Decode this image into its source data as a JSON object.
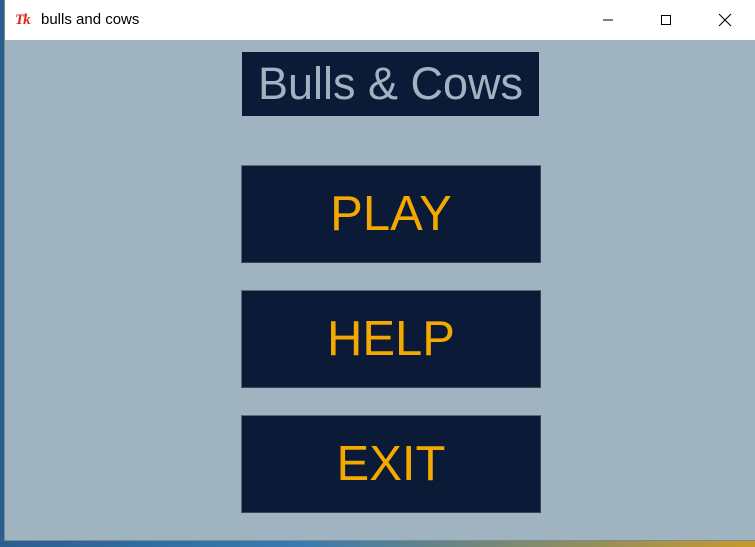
{
  "window": {
    "title": "bulls and cows",
    "icon": "tk-feather-icon",
    "icon_text": "Tk",
    "controls": [
      "minimize-icon",
      "maximize-icon",
      "close-icon"
    ]
  },
  "app": {
    "heading": "Bulls & Cows",
    "buttons": {
      "play": "PLAY",
      "help": "HELP",
      "exit": "EXIT"
    }
  },
  "colors": {
    "background": "#a0b3c1",
    "panel": "#0b1a36",
    "button_text": "#f5a800",
    "heading_text": "#a0b3c1"
  }
}
